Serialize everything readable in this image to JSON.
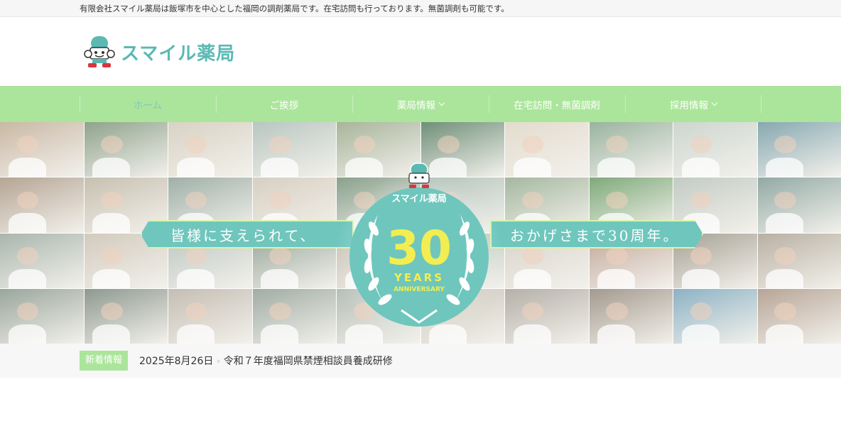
{
  "topbar": {
    "tagline": "有限会社スマイル薬局は飯塚市を中心とした福岡の調剤薬局です。在宅訪問も行っております。無菌調剤も可能です。"
  },
  "header": {
    "logo_text": "スマイル薬局"
  },
  "nav": {
    "items": [
      {
        "label": "ホーム",
        "active": true,
        "has_dropdown": false
      },
      {
        "label": "ご挨拶",
        "active": false,
        "has_dropdown": false
      },
      {
        "label": "薬局情報",
        "active": false,
        "has_dropdown": true
      },
      {
        "label": "在宅訪問・無菌調剤",
        "active": false,
        "has_dropdown": false
      },
      {
        "label": "採用情報",
        "active": false,
        "has_dropdown": true
      }
    ]
  },
  "hero": {
    "banner_left": "皆様に支えられて、",
    "banner_right": "おかげさまで30周年。",
    "emblem": {
      "brand": "スマイル薬局",
      "number": "30",
      "line1": "YEARS",
      "line2": "ANNIVERSARY"
    },
    "tile_colors": [
      "#c9b8a4",
      "#8fa38c",
      "#d8d2c4",
      "#b9c6c0",
      "#a7b49a",
      "#6f8f78",
      "#e3dccd",
      "#9ab39f",
      "#cdd6cf",
      "#86a8b0",
      "#b5a594",
      "#c7c0b0",
      "#9fb0a8",
      "#d7cfc2",
      "#8aa08c",
      "#b3c4bb",
      "#a5b8a0",
      "#7faa7a",
      "#c3cbc4",
      "#92a9a4",
      "#a9b6ad",
      "#d2cabd",
      "#bcc7c0",
      "#98a79b",
      "#c6beb1",
      "#b0c0b5",
      "#d9d4ca",
      "#c2a89a",
      "#a7a194",
      "#b8b0a2",
      "#9aa69c",
      "#8e9990",
      "#c4bdb2",
      "#a0aca3",
      "#b6bfb7",
      "#c9c4b8",
      "#b5b0a8",
      "#a49a8e",
      "#8cb2c4",
      "#b7a596"
    ]
  },
  "news": {
    "badge": "新着情報",
    "date": "2025年8月26日",
    "separator": "›",
    "title": "令和７年度福岡県禁煙相談員養成研修"
  }
}
